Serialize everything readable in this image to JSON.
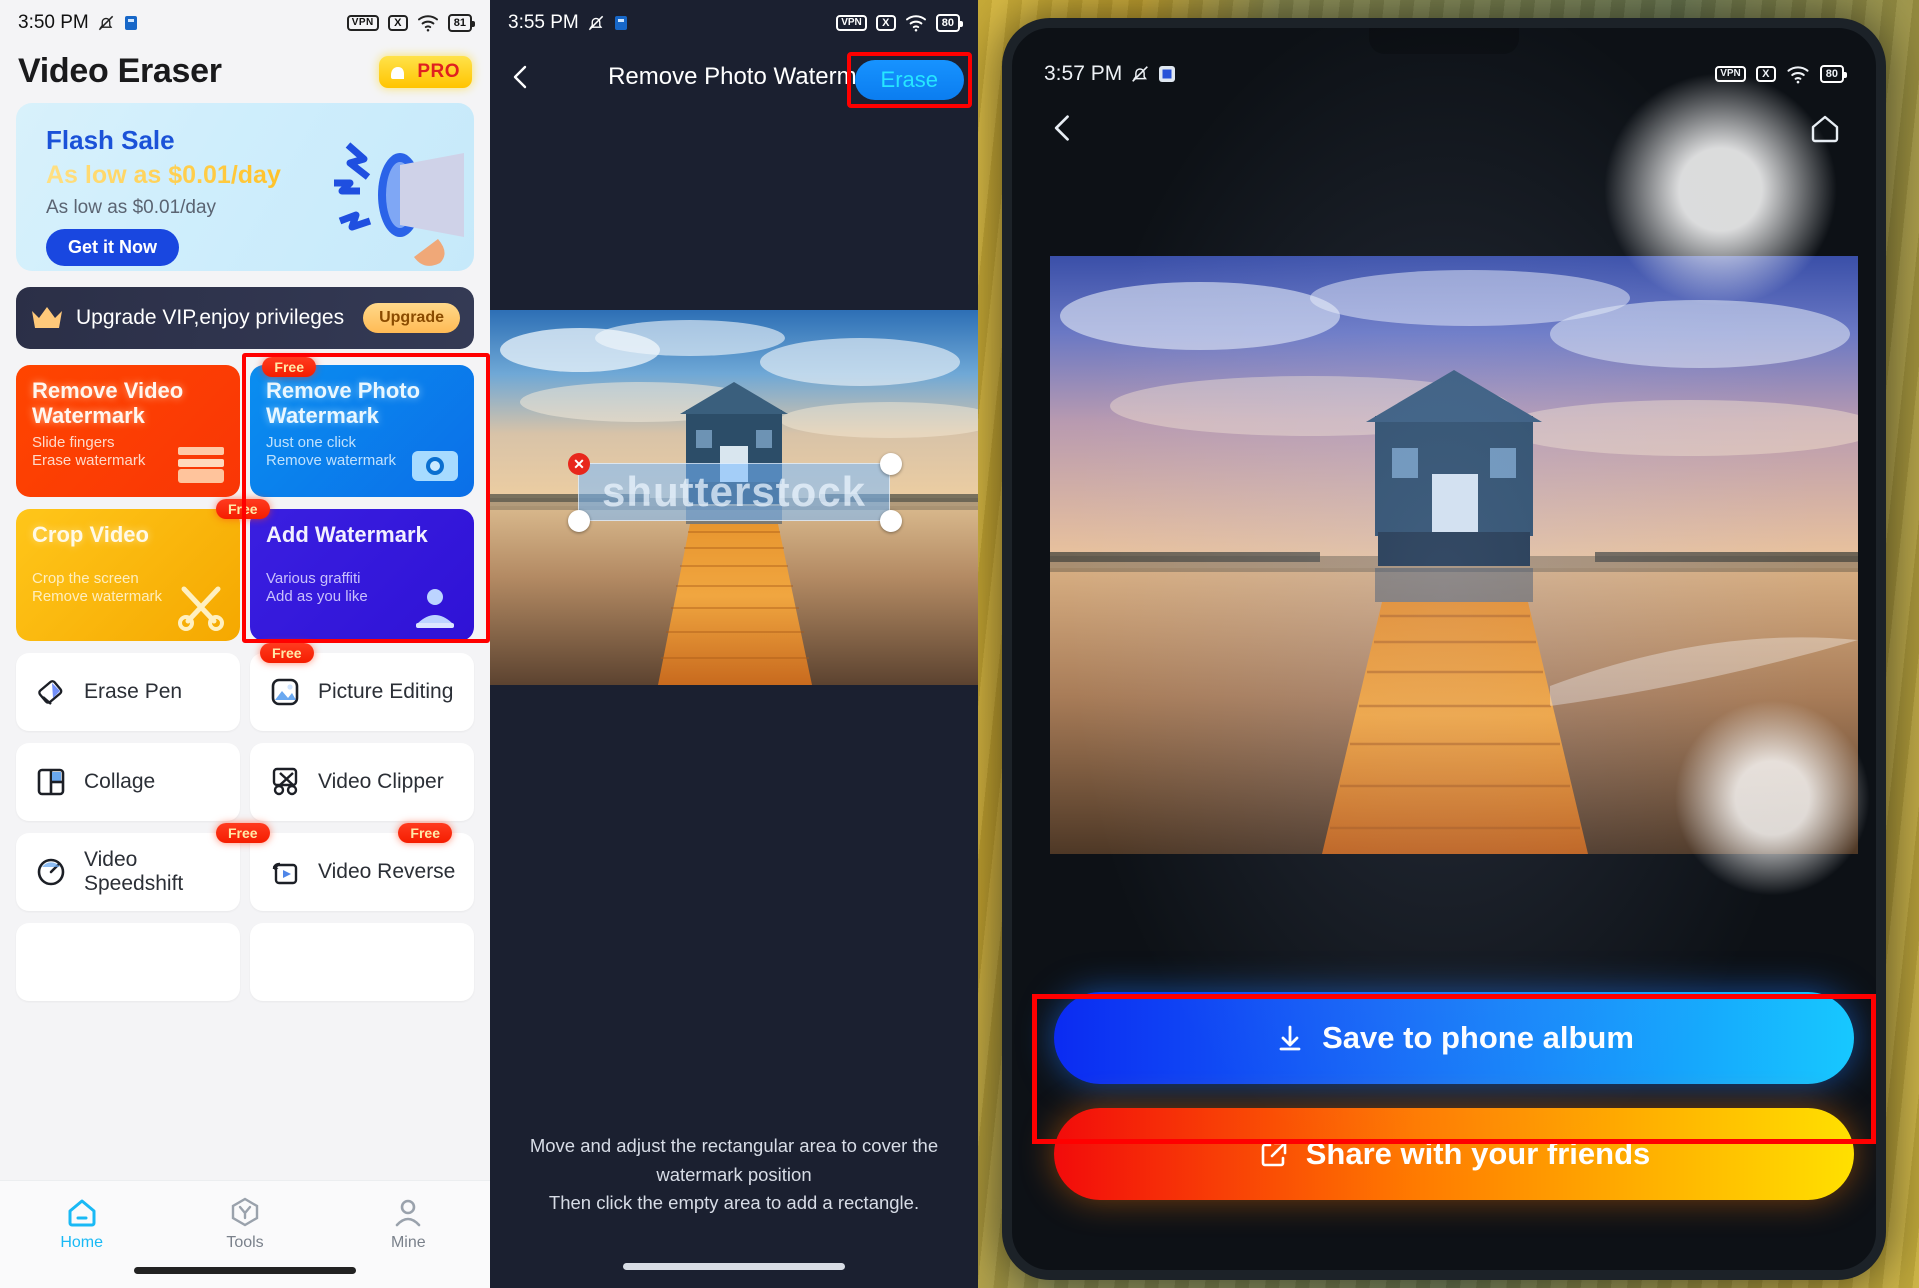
{
  "panel1": {
    "status": {
      "time": "3:50 PM",
      "mute_icon": "bell-muted-icon",
      "app_icon": "app-icon",
      "vpn": "VPN",
      "x": "X",
      "wifi": "wifi-icon",
      "battery": "81"
    },
    "app_title": "Video Eraser",
    "pro_badge": {
      "label": "PRO",
      "icon": "crown-thumb-icon"
    },
    "banner": {
      "title": "Flash Sale",
      "highlight": "As low as $0.01/day",
      "subtitle": "As low as $0.01/day",
      "cta": "Get it Now",
      "art": "megaphone-icon"
    },
    "vip": {
      "icon": "crown-icon",
      "text": "Upgrade VIP,enjoy privileges",
      "button": "Upgrade"
    },
    "cards": [
      {
        "title": "Remove Video Watermark",
        "sub1": "Slide fingers",
        "sub2": "Erase watermark",
        "color": "#ff4500",
        "icon": "film-strip-icon",
        "free": false,
        "highlighted": false
      },
      {
        "title": "Remove Photo Watermark",
        "sub1": "Just one click",
        "sub2": "Remove watermark",
        "color": "#0a8ef0",
        "icon": "camera-icon",
        "free": true,
        "free_label": "Free",
        "highlighted": true
      },
      {
        "title": "Crop Video",
        "sub1": "Crop the screen",
        "sub2": "Remove watermark",
        "color": "#ffc61a",
        "icon": "scissors-icon",
        "free": true,
        "free_label": "Free",
        "highlighted": false
      },
      {
        "title": "Add Watermark",
        "sub1": "Various graffiti",
        "sub2": "Add as you like",
        "color": "#3a1fe0",
        "icon": "stamp-icon",
        "free": false,
        "highlighted": false
      }
    ],
    "list": [
      {
        "label": "Erase Pen",
        "icon": "eraser-icon",
        "free": false
      },
      {
        "label": "Picture Editing",
        "icon": "photo-icon",
        "free": true,
        "free_label": "Free"
      },
      {
        "label": "Collage",
        "icon": "collage-icon",
        "free": false
      },
      {
        "label": "Video Clipper",
        "icon": "video-scissors-icon",
        "free": false
      },
      {
        "label": "Video Speedshift",
        "icon": "speedometer-icon",
        "free": true,
        "free_label": "Free"
      },
      {
        "label": "Video Reverse",
        "icon": "reverse-play-icon",
        "free": true,
        "free_label": "Free"
      }
    ],
    "nav": [
      {
        "label": "Home",
        "icon": "home-icon",
        "active": true
      },
      {
        "label": "Tools",
        "icon": "tools-hex-icon",
        "active": false
      },
      {
        "label": "Mine",
        "icon": "person-icon",
        "active": false
      }
    ]
  },
  "panel2": {
    "status": {
      "time": "3:55 PM",
      "mute_icon": "bell-muted-icon",
      "app_icon": "app-icon",
      "vpn": "VPN",
      "x": "X",
      "wifi": "wifi-icon",
      "battery": "80"
    },
    "back_icon": "chevron-left-icon",
    "title": "Remove Photo Watermark",
    "erase_button": "Erase",
    "watermark_text": "shutterstock",
    "footer_line1": "Move and adjust the rectangular area to cover the watermark position",
    "footer_line2": "Then click the empty area to add a rectangle.",
    "selection": {
      "delete_icon": "close-icon",
      "handle_icon": "resize-handle"
    }
  },
  "panel3": {
    "status": {
      "time": "3:57 PM",
      "mute_icon": "bell-muted-icon",
      "app_icon": "app-icon",
      "vpn": "VPN",
      "x": "X",
      "wifi": "wifi-icon",
      "battery": "80"
    },
    "back_icon": "chevron-left-icon",
    "home_icon": "home-outline-icon",
    "save_button": {
      "label": "Save to phone album",
      "icon": "download-icon"
    },
    "share_button": {
      "label": "Share with your friends",
      "icon": "share-icon"
    }
  },
  "colors": {
    "highlight_red": "#ff0000",
    "accent_blue": "#19b9f5",
    "brand_orange": "#ff4500",
    "free_badge": "#f51d00"
  }
}
